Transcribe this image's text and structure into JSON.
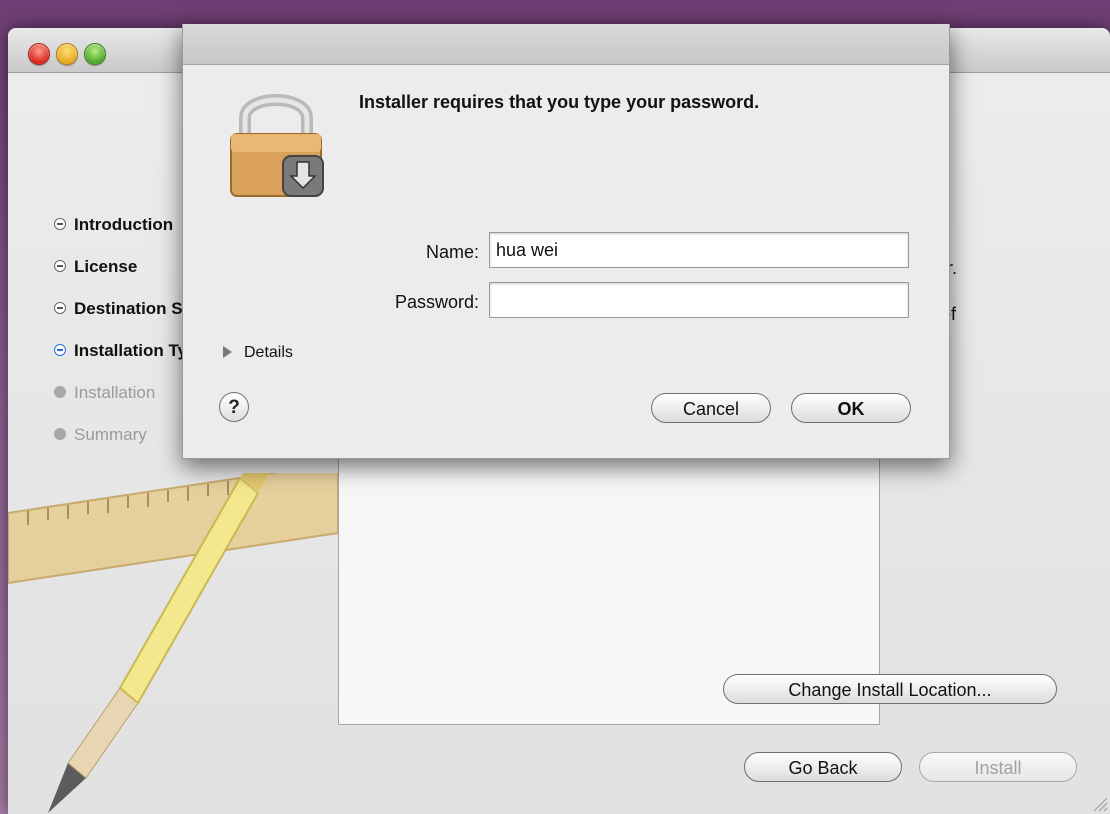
{
  "window": {
    "steps": [
      {
        "label": "Introduction",
        "state": "done"
      },
      {
        "label": "License",
        "state": "done"
      },
      {
        "label": "Destination Select",
        "state": "done"
      },
      {
        "label": "Installation Type",
        "state": "current"
      },
      {
        "label": "Installation",
        "state": "todo"
      },
      {
        "label": "Summary",
        "state": "todo"
      }
    ],
    "panel_text_line1": "er.",
    "panel_text_line2": "of",
    "change_location_label": "Change Install Location...",
    "go_back_label": "Go Back",
    "install_label": "Install"
  },
  "dialog": {
    "message": "Installer requires that you type your password.",
    "name_label": "Name:",
    "name_value": "hua wei",
    "password_label": "Password:",
    "password_value": "",
    "details_label": "Details",
    "help_label": "?",
    "cancel_label": "Cancel",
    "ok_label": "OK"
  },
  "icons": {
    "lock": "lock-installer-icon",
    "help": "question-icon",
    "disclosure": "disclosure-triangle-icon"
  },
  "colors": {
    "accent": "#2a6fd6",
    "desktop": "#8b5a8e"
  }
}
